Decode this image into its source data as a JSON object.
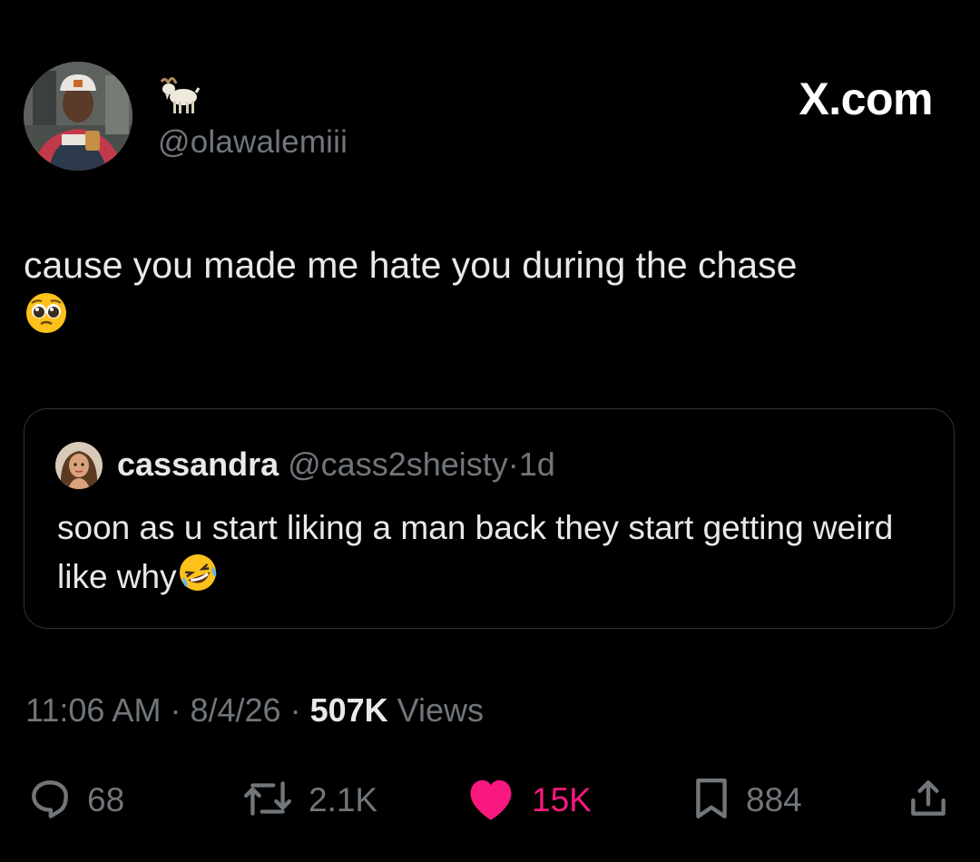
{
  "tweet": {
    "display_name_emoji": "goat-emoji",
    "handle": "@olawalemiii",
    "text": "cause you made me hate you during the chase",
    "text_emoji": "pleading-face-emoji"
  },
  "brand": {
    "label": "X.com"
  },
  "quoted_tweet": {
    "name": "cassandra",
    "handle": "@cass2sheisty",
    "separator": "·",
    "time": "1d",
    "text": "soon as u start liking a man back they start getting weird like why",
    "text_emoji": "rolling-on-floor-laughing-emoji"
  },
  "meta": {
    "time": "11:06 AM",
    "separator": "·",
    "date": "8/4/26",
    "views_count": "507K",
    "views_label": "Views"
  },
  "actions": {
    "replies": "68",
    "reposts": "2.1K",
    "likes": "15K",
    "bookmarks": "884"
  },
  "colors": {
    "background": "#000000",
    "text_primary": "#e7e9ea",
    "text_secondary": "#71767b",
    "like_accent": "#f91880",
    "border": "#2f3336"
  }
}
